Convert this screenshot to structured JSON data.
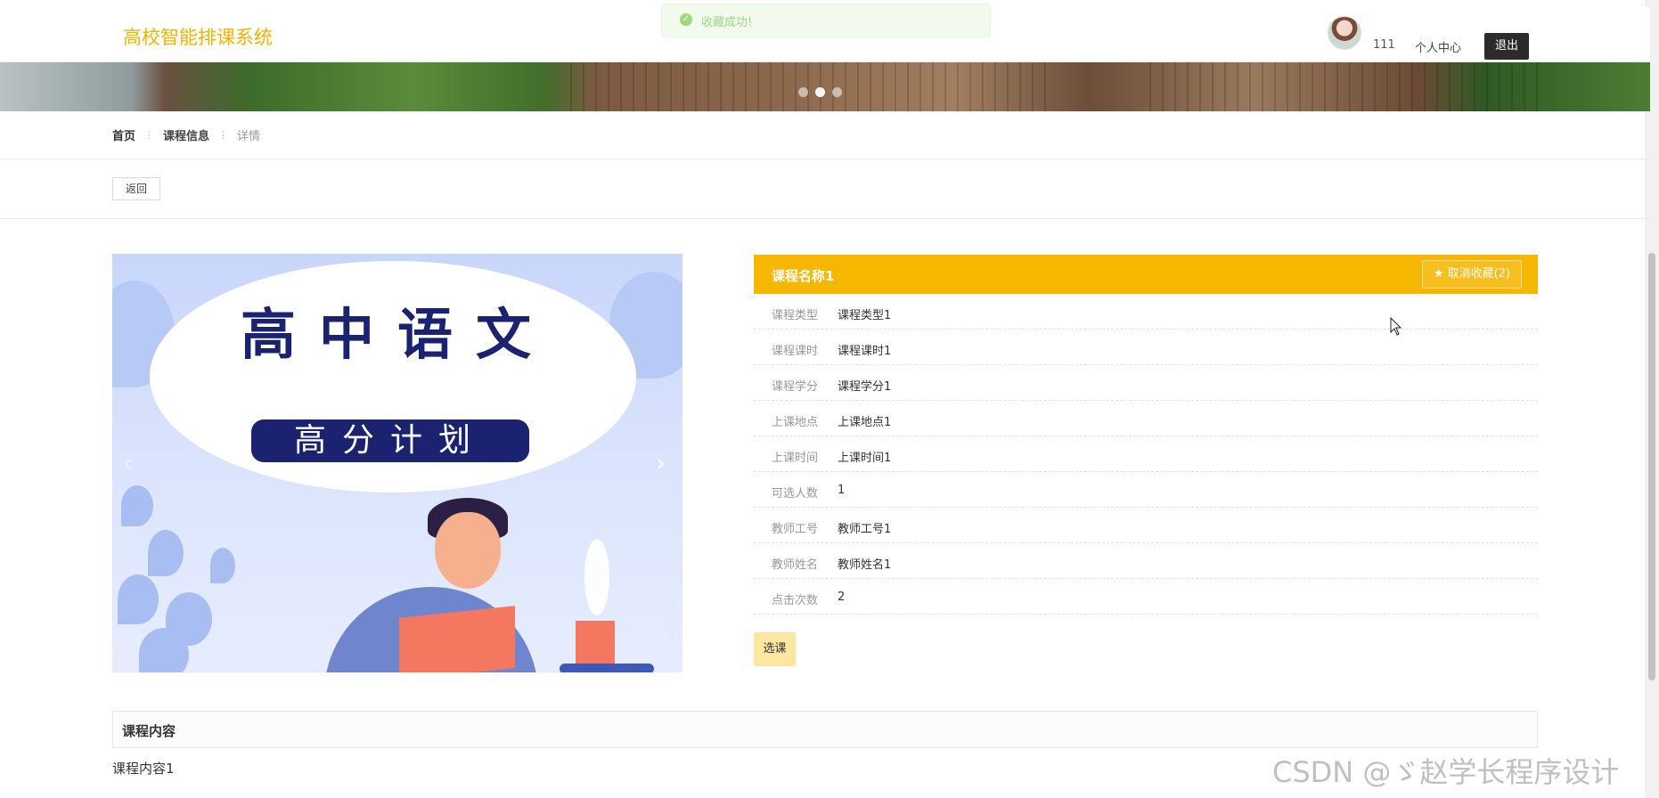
{
  "header": {
    "site_title": "高校智能排课系统",
    "username": "111",
    "personal_center": "个人中心",
    "logout": "退出"
  },
  "toast": {
    "message": "收藏成功!"
  },
  "breadcrumb": {
    "home": "首页",
    "course_info": "课程信息",
    "current": "详情"
  },
  "back_label": "返回",
  "course_image": {
    "title": "高中语文",
    "subtitle": "高分计划"
  },
  "course": {
    "name": "课程名称1",
    "favorite_label": "取消收藏(2)",
    "fields": [
      {
        "label": "课程类型",
        "value": "课程类型1"
      },
      {
        "label": "课程课时",
        "value": "课程课时1"
      },
      {
        "label": "课程学分",
        "value": "课程学分1"
      },
      {
        "label": "上课地点",
        "value": "上课地点1"
      },
      {
        "label": "上课时间",
        "value": "上课时间1"
      },
      {
        "label": "可选人数",
        "value": "1"
      },
      {
        "label": "教师工号",
        "value": "教师工号1"
      },
      {
        "label": "教师姓名",
        "value": "教师姓名1"
      },
      {
        "label": "点击次数",
        "value": "2"
      }
    ],
    "select_label": "选课"
  },
  "content": {
    "heading": "课程内容",
    "body": "课程内容1"
  },
  "watermark": "CSDN @ゞ赵学长程序设计",
  "icons": {
    "toast": "check-circle-icon",
    "favorite": "star-icon",
    "next": "chevron-right-icon",
    "prev": "chevron-left-icon"
  },
  "colors": {
    "accent": "#f5b700",
    "title": "#f0b400",
    "select_button": "#fbe7a2",
    "logout_bg": "#2b2b2b",
    "toast_text": "#8fd16a"
  },
  "carousel": {
    "dot_count": 3,
    "active_index": 1
  }
}
